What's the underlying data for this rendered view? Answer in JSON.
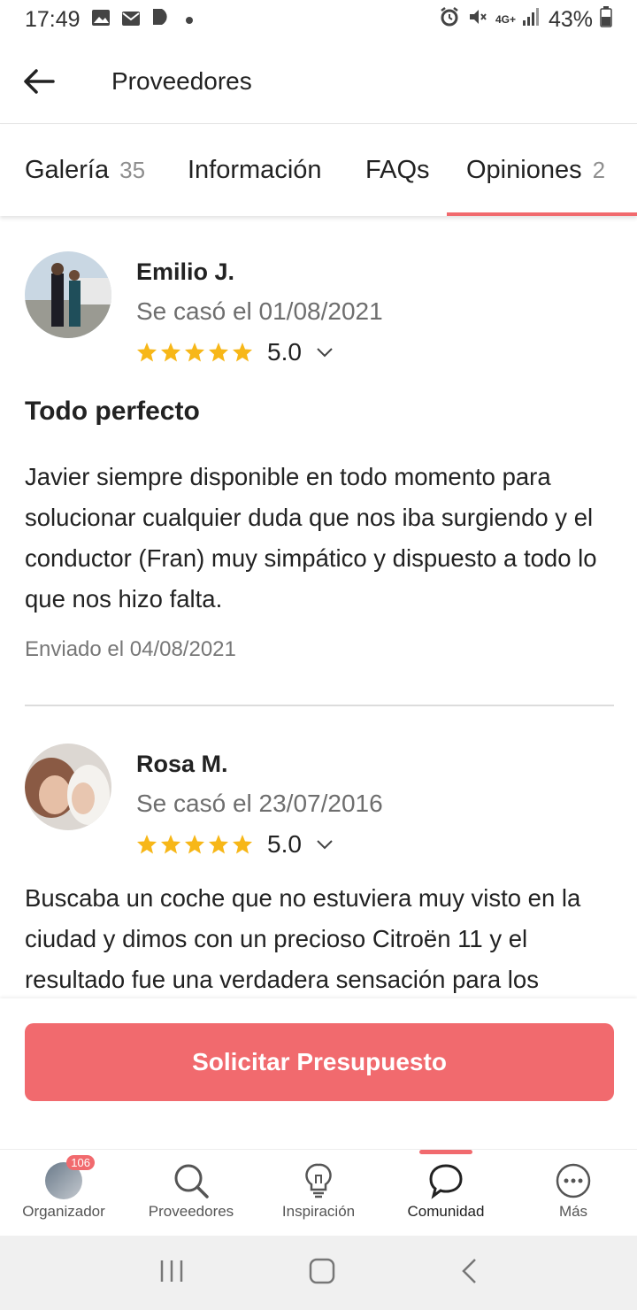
{
  "status_bar": {
    "time": "17:49",
    "network": "4G+",
    "battery": "43%",
    "icons": [
      "gallery-icon",
      "mail-icon",
      "app-icon",
      "dot-icon",
      "alarm-icon",
      "mute-icon",
      "signal-icon",
      "battery-icon"
    ]
  },
  "app_bar": {
    "title": "Proveedores",
    "back_icon": "arrow-left-icon"
  },
  "tabs": [
    {
      "label": "Galería",
      "count": "35",
      "active": false
    },
    {
      "label": "Información",
      "count": "",
      "active": false
    },
    {
      "label": "FAQs",
      "count": "",
      "active": false
    },
    {
      "label": "Opiniones",
      "count": "2",
      "active": true
    }
  ],
  "reviews": [
    {
      "name": "Emilio J.",
      "married": "Se casó el 01/08/2021",
      "stars": 5,
      "score": "5.0",
      "title": "Todo perfecto",
      "body": "Javier siempre disponible en todo momento para solucionar cualquier duda que nos iba surgiendo y el conductor (Fran) muy simpático y dispuesto a todo lo que nos hizo falta.",
      "sent": "Enviado el 04/08/2021"
    },
    {
      "name": "Rosa M.",
      "married": "Se casó el 23/07/2016",
      "stars": 5,
      "score": "5.0",
      "title": "",
      "body": "Buscaba un coche que no estuviera muy visto en la ciudad y dimos con un precioso Citroën 11 y el resultado fue una verdadera sensación para los",
      "sent": ""
    }
  ],
  "cta": {
    "label": "Solicitar Presupuesto"
  },
  "bottom_nav": [
    {
      "label": "Organizador",
      "icon": "avatar-icon",
      "badge": "106",
      "active": false
    },
    {
      "label": "Proveedores",
      "icon": "search-icon",
      "active": false
    },
    {
      "label": "Inspiración",
      "icon": "lightbulb-icon",
      "active": false
    },
    {
      "label": "Comunidad",
      "icon": "chat-bubble-icon",
      "active": true
    },
    {
      "label": "Más",
      "icon": "more-icon",
      "active": false
    }
  ],
  "colors": {
    "accent": "#f16a6e",
    "star": "#f7b718",
    "muted": "#8e8e8e"
  }
}
